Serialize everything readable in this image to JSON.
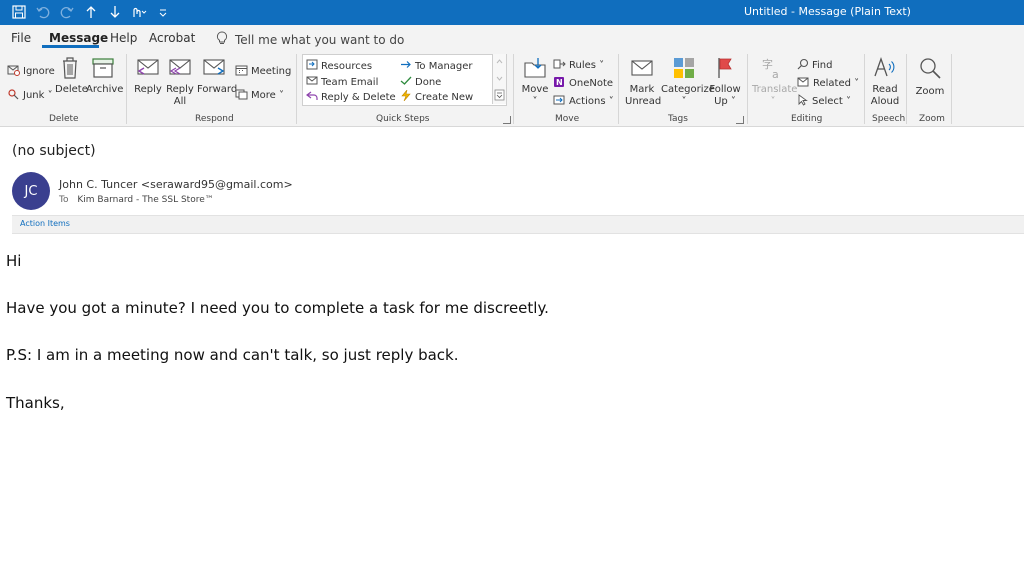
{
  "window": {
    "title": "Untitled  -  Message (Plain Text)"
  },
  "menu": {
    "tabs": [
      "File",
      "Message",
      "Help",
      "Acrobat"
    ],
    "active_tab": "Message",
    "tell_me": "Tell me what you want to do"
  },
  "ribbon": {
    "delete_group": {
      "ignore": "Ignore",
      "junk": "Junk ˅",
      "delete": "Delete",
      "archive": "Archive",
      "label": "Delete"
    },
    "respond_group": {
      "reply": "Reply",
      "reply_all_1": "Reply",
      "reply_all_2": "All",
      "forward": "Forward",
      "meeting": "Meeting",
      "more": "More ˅",
      "label": "Respond"
    },
    "quick_steps": {
      "resources": "Resources",
      "team_email": "Team Email",
      "reply_delete": "Reply & Delete",
      "to_manager": "To Manager",
      "done": "Done",
      "create_new": "Create New",
      "label": "Quick Steps"
    },
    "move_group": {
      "move": "Move",
      "rules": "Rules ˅",
      "onenote": "OneNote",
      "actions": "Actions ˅",
      "label": "Move"
    },
    "tags_group": {
      "mark_unread_1": "Mark",
      "mark_unread_2": "Unread",
      "categorize": "Categorize",
      "follow_up_1": "Follow",
      "follow_up_2": "Up ˅",
      "label": "Tags"
    },
    "editing_group": {
      "translate": "Translate",
      "find": "Find",
      "related": "Related ˅",
      "select": "Select ˅",
      "label": "Editing"
    },
    "speech_group": {
      "read_aloud_1": "Read",
      "read_aloud_2": "Aloud",
      "label": "Speech"
    },
    "zoom_group": {
      "zoom": "Zoom",
      "label": "Zoom"
    }
  },
  "message": {
    "subject": "(no subject)",
    "avatar_initials": "JC",
    "from": "John C. Tuncer <seraward95@gmail.com>",
    "to_label": "To",
    "to": "Kim Barnard - The SSL Store™",
    "action_items": "Action Items",
    "body": [
      "Hi",
      "Have you got a minute? I need you to complete a task for me discreetly.",
      "P.S: I am in a meeting now and can't talk, so just reply back.",
      "Thanks,"
    ]
  },
  "colors": {
    "titlebar": "#106ebe",
    "avatar": "#3a3f8f",
    "accent": "#106ebe"
  }
}
